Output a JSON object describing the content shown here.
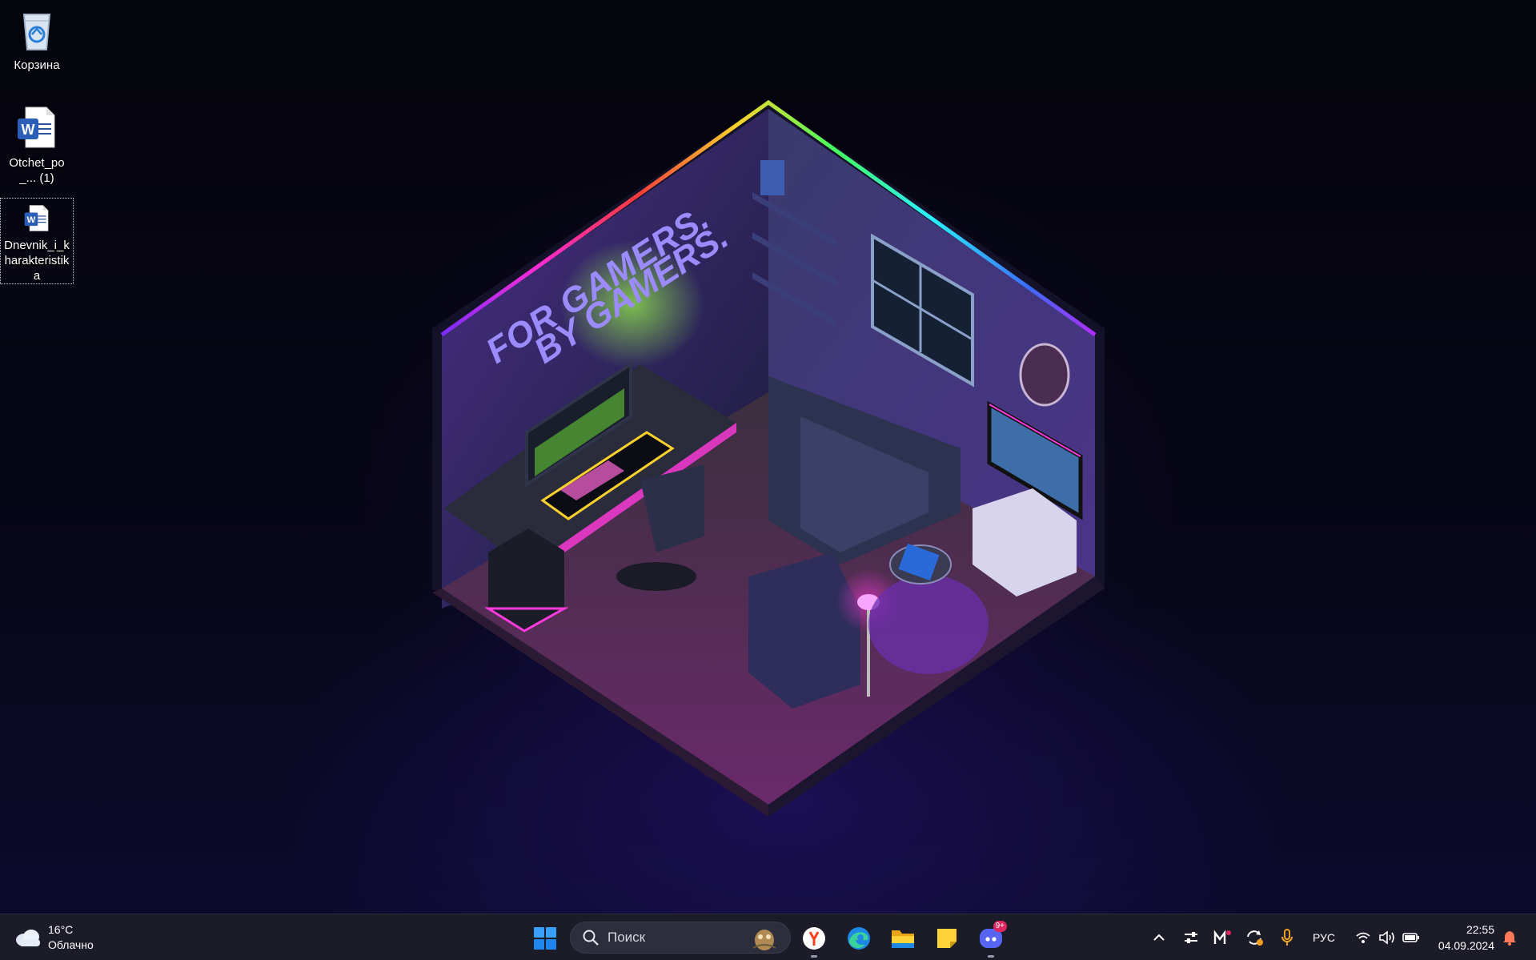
{
  "wallpaper": {
    "neon_line1": "FOR GAMERS.",
    "neon_line2": "BY GAMERS."
  },
  "desktop": {
    "icons": [
      {
        "label": "Корзина",
        "icon": "recycle-bin-icon"
      },
      {
        "label": "Otchet_po_... (1)",
        "icon": "word-document-icon"
      },
      {
        "label": "Dnevnik_i_kharakteristika",
        "icon": "word-document-icon",
        "selected": true
      }
    ]
  },
  "taskbar": {
    "weather": {
      "temperature": "16°C",
      "condition": "Облачно",
      "icon": "cloud-icon"
    },
    "search": {
      "placeholder": "Поиск"
    },
    "pinned": [
      {
        "name": "start",
        "icon": "windows-logo-icon"
      },
      {
        "name": "yandex-browser",
        "icon": "yandex-icon"
      },
      {
        "name": "edge",
        "icon": "edge-icon"
      },
      {
        "name": "file-explorer",
        "icon": "folder-icon"
      },
      {
        "name": "sticky-notes",
        "icon": "sticky-notes-icon"
      },
      {
        "name": "discord",
        "icon": "discord-icon",
        "badge": "9+"
      }
    ],
    "tray": {
      "language": "РУС",
      "icons": [
        "chevron-up-icon",
        "sliders-icon",
        "m-app-icon",
        "sync-icon",
        "microphone-icon",
        "wifi-icon",
        "volume-icon",
        "battery-icon",
        "bell-icon"
      ]
    },
    "clock": {
      "time": "22:55",
      "date": "04.09.2024"
    }
  },
  "colors": {
    "taskbar_bg": "#1b1c28",
    "accent": "#0078d4",
    "mic_accent": "#f0a020",
    "badge": "#e0245e"
  }
}
